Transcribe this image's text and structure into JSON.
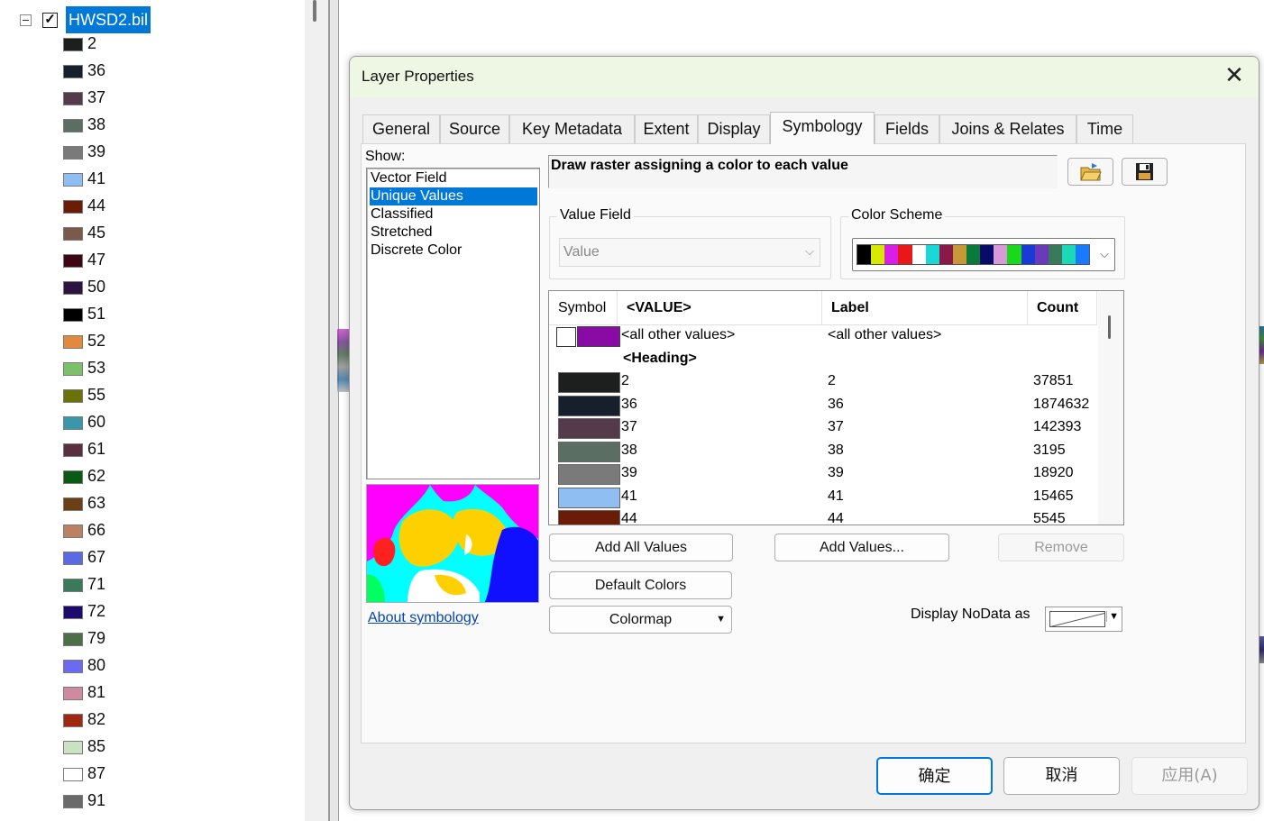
{
  "toc": {
    "layer_name": "HWSD2.bil",
    "legend": [
      {
        "label": "2",
        "color": "#1d1e1e"
      },
      {
        "label": "36",
        "color": "#16202d"
      },
      {
        "label": "37",
        "color": "#553a4c"
      },
      {
        "label": "38",
        "color": "#5a6e63"
      },
      {
        "label": "39",
        "color": "#7a7a7a"
      },
      {
        "label": "41",
        "color": "#8fbff2"
      },
      {
        "label": "44",
        "color": "#6b1c06"
      },
      {
        "label": "45",
        "color": "#7a5a4a"
      },
      {
        "label": "47",
        "color": "#3e0614"
      },
      {
        "label": "50",
        "color": "#2c1440"
      },
      {
        "label": "51",
        "color": "#000000"
      },
      {
        "label": "52",
        "color": "#e28a3c"
      },
      {
        "label": "53",
        "color": "#7cc06a"
      },
      {
        "label": "55",
        "color": "#6b7308"
      },
      {
        "label": "60",
        "color": "#3a96aa"
      },
      {
        "label": "61",
        "color": "#5a3040"
      },
      {
        "label": "62",
        "color": "#0a5a14"
      },
      {
        "label": "63",
        "color": "#6a4014"
      },
      {
        "label": "66",
        "color": "#ba8262"
      },
      {
        "label": "67",
        "color": "#5a6ae2"
      },
      {
        "label": "71",
        "color": "#3a7a5a"
      },
      {
        "label": "72",
        "color": "#1e0a6e"
      },
      {
        "label": "79",
        "color": "#4e6e4a"
      },
      {
        "label": "80",
        "color": "#6a6af2"
      },
      {
        "label": "81",
        "color": "#d08aa0"
      },
      {
        "label": "82",
        "color": "#a02810"
      },
      {
        "label": "85",
        "color": "#c8e2c2"
      },
      {
        "label": "87",
        "color": "#ffffff"
      },
      {
        "label": "91",
        "color": "#6a6a6a"
      }
    ]
  },
  "dialog": {
    "title": "Layer Properties",
    "tabs": [
      "General",
      "Source",
      "Key Metadata",
      "Extent",
      "Display",
      "Symbology",
      "Fields",
      "Joins & Relates",
      "Time"
    ],
    "active_tab": "Symbology",
    "show_label": "Show:",
    "show_items": [
      "Vector Field",
      "Unique Values",
      "Classified",
      "Stretched",
      "Discrete Color"
    ],
    "selected_show": "Unique Values",
    "description": "Draw raster assigning a color to each value",
    "value_field": {
      "legend": "Value Field",
      "value": "Value"
    },
    "color_scheme": {
      "legend": "Color Scheme",
      "colors": [
        "#000000",
        "#d8e800",
        "#d81ee8",
        "#e81818",
        "#ffffff",
        "#18d8d8",
        "#8a1848",
        "#c89838",
        "#0a7a3a",
        "#0a0a6a",
        "#d89ad8",
        "#1ad81a",
        "#1a3ad8",
        "#6a3aba",
        "#3a7a5a",
        "#1ad8b8",
        "#1a7aff"
      ]
    },
    "table": {
      "headers": [
        "Symbol",
        "<VALUE>",
        "Label",
        "Count"
      ],
      "other_row": {
        "value": "<all other values>",
        "label": "<all other values>",
        "color": "#8a0aa6"
      },
      "heading_row": "<Heading>",
      "rows": [
        {
          "value": "2",
          "label": "2",
          "count": "37851",
          "color": "#1d1e1e"
        },
        {
          "value": "36",
          "label": "36",
          "count": "1874632",
          "color": "#16202d"
        },
        {
          "value": "37",
          "label": "37",
          "count": "142393",
          "color": "#553a4c"
        },
        {
          "value": "38",
          "label": "38",
          "count": "3195",
          "color": "#5a6e63"
        },
        {
          "value": "39",
          "label": "39",
          "count": "18920",
          "color": "#7a7a7a"
        },
        {
          "value": "41",
          "label": "41",
          "count": "15465",
          "color": "#8fbff2"
        },
        {
          "value": "44",
          "label": "44",
          "count": "5545",
          "color": "#6b1c06"
        }
      ]
    },
    "buttons": {
      "add_all_values": "Add All Values",
      "add_values": "Add Values...",
      "remove": "Remove",
      "default_colors": "Default Colors",
      "colormap": "Colormap"
    },
    "about_link": "About symbology",
    "nodata_label": "Display NoData as",
    "footer": {
      "ok": "确定",
      "cancel": "取消",
      "apply": "应用(A)"
    }
  }
}
